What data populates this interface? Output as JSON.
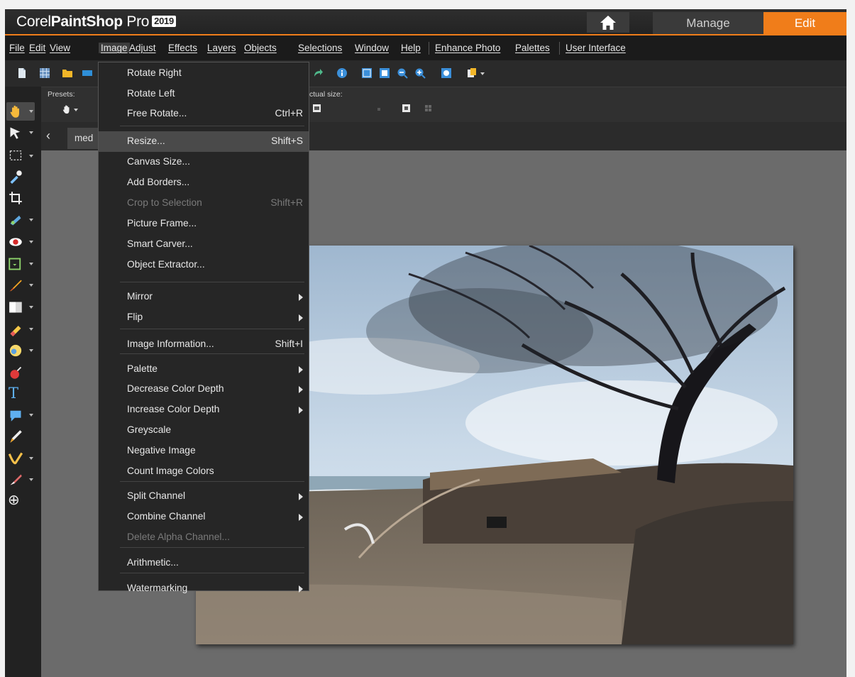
{
  "app": {
    "brand_corel": "Corel",
    "brand_product": "PaintShop",
    "brand_pro": "Pro",
    "brand_year": "2019"
  },
  "workspace_tabs": {
    "manage": "Manage",
    "edit": "Edit"
  },
  "menubar": {
    "items": [
      "File",
      "Edit",
      "View",
      "Image",
      "Adjust",
      "Effects",
      "Layers",
      "Objects",
      "Selections",
      "Window",
      "Help",
      "Enhance Photo",
      "Palettes",
      "User Interface"
    ]
  },
  "options": {
    "presets_label": "Presets:",
    "actual_size_label": "ctual size:"
  },
  "document": {
    "tab_label": "med"
  },
  "image_menu": {
    "items": [
      {
        "label": "Rotate Right",
        "shortcut": "",
        "submenu": false,
        "disabled": false
      },
      {
        "label": "Rotate Left",
        "shortcut": "",
        "submenu": false,
        "disabled": false
      },
      {
        "label": "Free Rotate...",
        "shortcut": "Ctrl+R",
        "submenu": false,
        "disabled": false
      },
      {
        "label": "Resize...",
        "shortcut": "Shift+S",
        "submenu": false,
        "disabled": false,
        "highlighted": true
      },
      {
        "label": "Canvas Size...",
        "shortcut": "",
        "submenu": false,
        "disabled": false
      },
      {
        "label": "Add Borders...",
        "shortcut": "",
        "submenu": false,
        "disabled": false
      },
      {
        "label": "Crop to Selection",
        "shortcut": "Shift+R",
        "submenu": false,
        "disabled": true
      },
      {
        "label": "Picture Frame...",
        "shortcut": "",
        "submenu": false,
        "disabled": false
      },
      {
        "label": "Smart Carver...",
        "shortcut": "",
        "submenu": false,
        "disabled": false
      },
      {
        "label": "Object Extractor...",
        "shortcut": "",
        "submenu": false,
        "disabled": false
      },
      {
        "label": "Mirror",
        "shortcut": "",
        "submenu": true,
        "disabled": false
      },
      {
        "label": "Flip",
        "shortcut": "",
        "submenu": true,
        "disabled": false
      },
      {
        "label": "Image Information...",
        "shortcut": "Shift+I",
        "submenu": false,
        "disabled": false
      },
      {
        "label": "Palette",
        "shortcut": "",
        "submenu": true,
        "disabled": false
      },
      {
        "label": "Decrease Color Depth",
        "shortcut": "",
        "submenu": true,
        "disabled": false
      },
      {
        "label": "Increase Color Depth",
        "shortcut": "",
        "submenu": true,
        "disabled": false
      },
      {
        "label": "Greyscale",
        "shortcut": "",
        "submenu": false,
        "disabled": false
      },
      {
        "label": "Negative Image",
        "shortcut": "",
        "submenu": false,
        "disabled": false
      },
      {
        "label": "Count Image Colors",
        "shortcut": "",
        "submenu": false,
        "disabled": false
      },
      {
        "label": "Split Channel",
        "shortcut": "",
        "submenu": true,
        "disabled": false
      },
      {
        "label": "Combine Channel",
        "shortcut": "",
        "submenu": true,
        "disabled": false
      },
      {
        "label": "Delete Alpha Channel...",
        "shortcut": "",
        "submenu": false,
        "disabled": true
      },
      {
        "label": "Arithmetic...",
        "shortcut": "",
        "submenu": false,
        "disabled": false
      },
      {
        "label": "Watermarking",
        "shortcut": "",
        "submenu": true,
        "disabled": false
      }
    ]
  },
  "tools": {
    "text_tool_glyph": "T",
    "add_tool_glyph": "⊕"
  },
  "colors": {
    "accent": "#f07d1a",
    "menubar": "#1b1b1b",
    "workspace": "#6b6b6b"
  }
}
